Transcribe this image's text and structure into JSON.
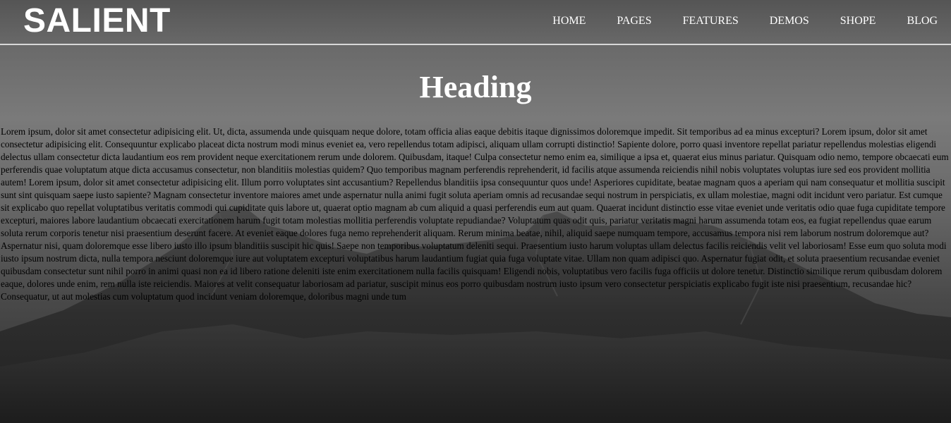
{
  "header": {
    "logo": "SALIENT",
    "nav": [
      "HOME",
      "PAGES",
      "FEATURES",
      "DEMOS",
      "SHOPE",
      "BLOG"
    ]
  },
  "main": {
    "heading": "Heading",
    "body": "Lorem ipsum, dolor sit amet consectetur adipisicing elit. Ut, dicta, assumenda unde quisquam neque dolore, totam officia alias eaque debitis itaque dignissimos doloremque impedit. Sit temporibus ad ea minus excepturi? Lorem ipsum, dolor sit amet consectetur adipisicing elit. Consequuntur explicabo placeat dicta nostrum modi minus eveniet ea, vero repellendus totam adipisci, aliquam ullam corrupti distinctio! Sapiente dolore, porro quasi inventore repellat pariatur repellendus molestias eligendi delectus ullam consectetur dicta laudantium eos rem provident neque exercitationem rerum unde dolorem. Quibusdam, itaque! Culpa consectetur nemo enim ea, similique a ipsa et, quaerat eius minus pariatur. Quisquam odio nemo, tempore obcaecati eum perferendis quae voluptatum atque dicta accusamus consectetur, non blanditiis molestias quidem? Quo temporibus magnam perferendis reprehenderit, id facilis atque assumenda reiciendis nihil nobis voluptates voluptas iure sed eos provident mollitia autem! Lorem ipsum, dolor sit amet consectetur adipisicing elit. Illum porro voluptates sint accusantium? Repellendus blanditiis ipsa consequuntur quos unde! Asperiores cupiditate, beatae magnam quos a aperiam qui nam consequatur et mollitia suscipit sunt sint quisquam saepe iusto sapiente? Magnam consectetur inventore maiores amet unde aspernatur nulla animi fugit soluta aperiam omnis ad recusandae sequi nostrum in perspiciatis, ex ullam molestiae, magni odit incidunt vero pariatur. Est cumque sit explicabo quo repellat voluptatibus veritatis commodi qui cupiditate quis labore ut, quaerat optio magnam ab cum aliquid a quasi perferendis eum aut quam. Quaerat incidunt distinctio esse vitae eveniet unde veritatis odio quae fuga cupiditate tempore excepturi, maiores labore laudantium obcaecati exercitationem harum fugit totam molestias mollitia perferendis voluptate repudiandae? Voluptatum quas odit quis, pariatur veritatis magni harum assumenda totam eos, ea fugiat repellendus quae earum soluta rerum corporis tenetur nisi praesentium deserunt facere. At eveniet eaque dolores fuga nemo reprehenderit aliquam. Rerum minima beatae, nihil, aliquid saepe numquam tempore, accusamus tempora nisi rem laborum nostrum doloremque aut? Aspernatur nisi, quam doloremque esse libero iusto illo ipsum blanditiis suscipit hic quis! Saepe non temporibus voluptatum deleniti sequi. Praesentium iusto harum voluptas ullam delectus facilis reiciendis velit vel laboriosam! Esse eum quo soluta modi iusto ipsum nostrum dicta, nulla tempora nesciunt doloremque iure aut voluptatem excepturi voluptatibus harum laudantium fugiat quia fuga voluptate vitae. Ullam non quam adipisci quo. Aspernatur fugiat odit, et soluta praesentium recusandae eveniet quibusdam consectetur sunt nihil porro in animi quasi non ea id libero ratione deleniti iste enim exercitationem nulla facilis quisquam! Eligendi nobis, voluptatibus vero facilis fuga officiis ut dolore tenetur. Distinctio similique rerum quibusdam dolorem eaque, dolores unde enim, rem nulla iste reiciendis. Maiores at velit consequatur laboriosam ad pariatur, suscipit minus eos porro quibusdam nostrum iusto ipsum vero consectetur perspiciatis explicabo fugit iste nisi praesentium, recusandae hic? Consequatur, ut aut molestias cum voluptatum quod incidunt veniam doloremque, doloribus magni unde tum"
  },
  "colors": {
    "text_light": "#ffffff",
    "body_text": "#000000",
    "divider": "#d8d8d8"
  }
}
